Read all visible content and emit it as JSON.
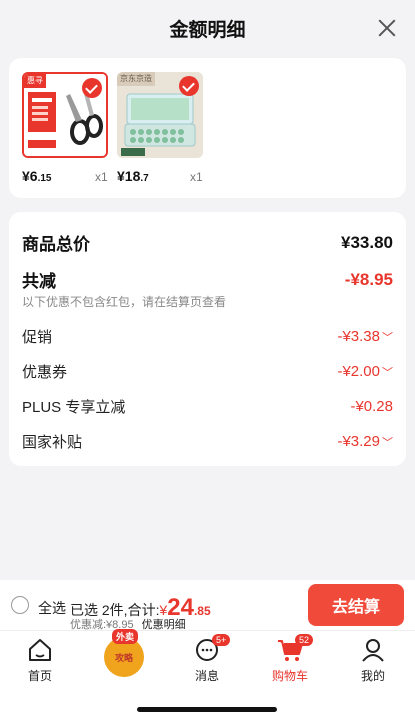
{
  "header": {
    "title": "金额明细"
  },
  "products": [
    {
      "tag": "惠寻",
      "price_main": "¥6",
      "price_dec": ".15",
      "qty": "x1"
    },
    {
      "tag": "京东京造",
      "price_main": "¥18",
      "price_dec": ".7",
      "qty": "x1"
    }
  ],
  "detail": {
    "total_label": "商品总价",
    "total_value": "¥33.80",
    "reduce_label": "共减",
    "reduce_value": "-¥8.95",
    "note": "以下优惠不包含红包，请在结算页查看",
    "items": [
      {
        "label": "促销",
        "value": "-¥3.38"
      },
      {
        "label": "优惠券",
        "value": "-¥2.00"
      },
      {
        "label": "PLUS 专享立减",
        "value": "-¥0.28"
      },
      {
        "label": "国家补贴",
        "value": "-¥3.29"
      }
    ]
  },
  "bottom": {
    "select_all": "全选",
    "summary_prefix": "已选 2件,合计:",
    "currency": "¥",
    "amount_int": "24",
    "amount_dec": ".85",
    "discount": "优惠减:¥8.95",
    "detail_link": "优惠明细",
    "checkout": "去结算"
  },
  "tabs": [
    {
      "label": "首页"
    },
    {
      "label": "攻略",
      "badge": "外卖"
    },
    {
      "label": "消息",
      "badge": "5+"
    },
    {
      "label": "购物车",
      "badge": "52"
    },
    {
      "label": "我的"
    }
  ],
  "colors": {
    "accent": "#e8362d",
    "checkout_bg": "#f04b3a"
  }
}
